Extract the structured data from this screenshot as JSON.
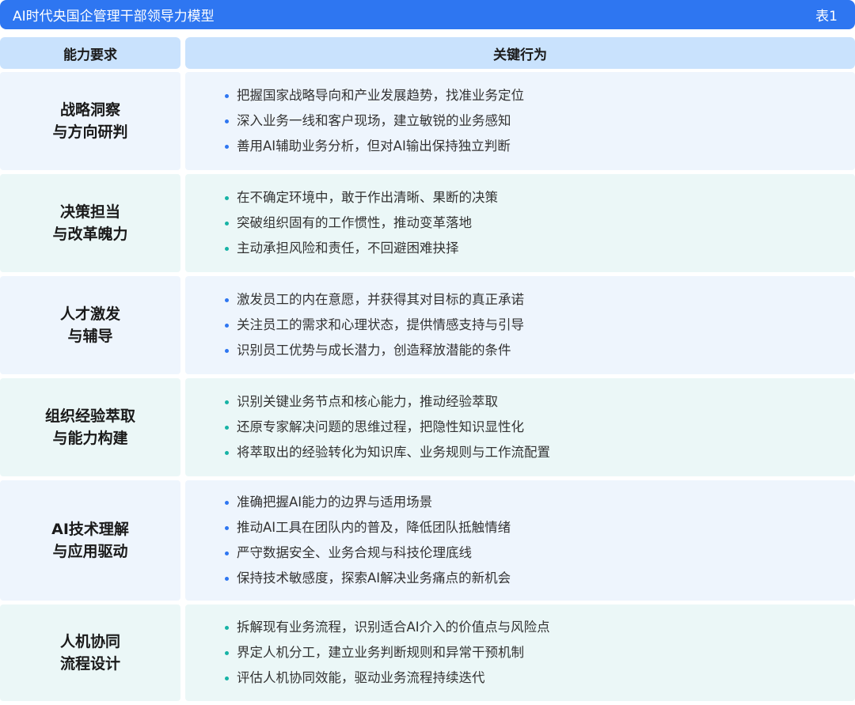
{
  "header": {
    "title": "AI时代央国企管理干部领导力模型",
    "table_no": "表1"
  },
  "columns": [
    "能力要求",
    "关键行为"
  ],
  "rows": [
    {
      "capability": "战略洞察\n与方向研判",
      "theme": "blue",
      "behaviors": [
        "把握国家战略导向和产业发展趋势，找准业务定位",
        "深入业务一线和客户现场，建立敏锐的业务感知",
        "善用AI辅助业务分析，但对AI输出保持独立判断"
      ]
    },
    {
      "capability": "决策担当\n与改革魄力",
      "theme": "teal",
      "behaviors": [
        "在不确定环境中，敢于作出清晰、果断的决策",
        "突破组织固有的工作惯性，推动变革落地",
        "主动承担风险和责任，不回避困难抉择"
      ]
    },
    {
      "capability": "人才激发\n与辅导",
      "theme": "blue",
      "behaviors": [
        "激发员工的内在意愿，并获得其对目标的真正承诺",
        "关注员工的需求和心理状态，提供情感支持与引导",
        "识别员工优势与成长潜力，创造释放潜能的条件"
      ]
    },
    {
      "capability": "组织经验萃取\n与能力构建",
      "theme": "teal",
      "behaviors": [
        "识别关键业务节点和核心能力，推动经验萃取",
        "还原专家解决问题的思维过程，把隐性知识显性化",
        "将萃取出的经验转化为知识库、业务规则与工作流配置"
      ]
    },
    {
      "capability": "AI技术理解\n与应用驱动",
      "theme": "blue",
      "behaviors": [
        "准确把握AI能力的边界与适用场景",
        "推动AI工具在团队内的普及，降低团队抵触情绪",
        "严守数据安全、业务合规与科技伦理底线",
        "保持技术敏感度，探索AI解决业务痛点的新机会"
      ]
    },
    {
      "capability": "人机协同\n流程设计",
      "theme": "teal",
      "behaviors": [
        "拆解现有业务流程，识别适合AI介入的价值点与风险点",
        "界定人机分工，建立业务判断规则和异常干预机制",
        "评估人机协同效能，驱动业务流程持续迭代"
      ]
    }
  ]
}
